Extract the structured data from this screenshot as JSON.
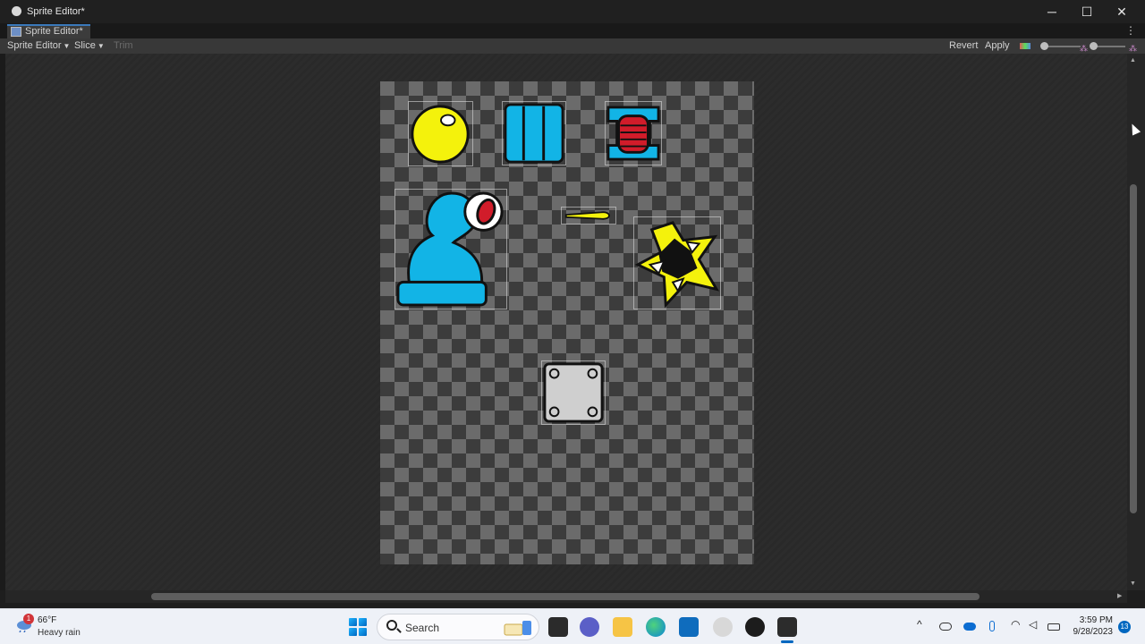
{
  "window": {
    "title": "Sprite Editor*",
    "app_icon": "unity-icon"
  },
  "window_controls": {
    "minimize": "─",
    "maximize": "☐",
    "close": "✕"
  },
  "tab": {
    "label": "Sprite Editor*",
    "icon": "sprite-editor-icon",
    "menu": "⋮"
  },
  "toolbar": {
    "mode_dropdown": "Sprite Editor",
    "slice_dropdown": "Slice",
    "trim": "Trim",
    "revert": "Revert",
    "apply": "Apply",
    "channel_icon": "rgb-channels-icon",
    "zoom_slider_value": 0.0,
    "mip_slider_value": 0.0
  },
  "sprites": [
    {
      "name": "yellow-ball",
      "icon": "ball"
    },
    {
      "name": "blue-block",
      "icon": "block"
    },
    {
      "name": "red-spring",
      "icon": "spring"
    },
    {
      "name": "cannon",
      "icon": "cannon"
    },
    {
      "name": "bullet",
      "icon": "bullet"
    },
    {
      "name": "explosion",
      "icon": "explosion"
    },
    {
      "name": "metal-plate",
      "icon": "plate"
    }
  ],
  "taskbar": {
    "weather": {
      "badge": "1",
      "temp": "66°F",
      "condition": "Heavy rain"
    },
    "search": {
      "label": "Search"
    },
    "apps": [
      "file-explorer-dark",
      "teams-chat",
      "file-explorer",
      "edge",
      "outlook",
      "unity-hub",
      "chatgpt",
      "unity-editor"
    ],
    "tray": {
      "chevron": "^",
      "time": "3:59 PM",
      "date": "9/28/2023",
      "notifications": "13"
    }
  }
}
